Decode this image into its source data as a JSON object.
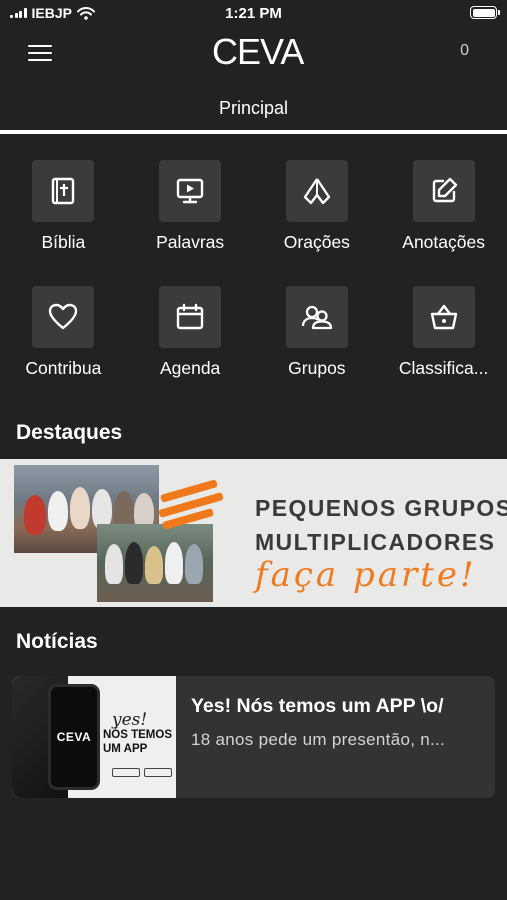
{
  "status_bar": {
    "carrier": "IEBJP",
    "time": "1:21 PM"
  },
  "header": {
    "logo_text": "CEVA",
    "counter": "0",
    "title": "Principal",
    "menu_icon": "hamburger-menu-icon"
  },
  "menu": {
    "items": [
      {
        "label": "Bíblia",
        "icon": "bible-icon"
      },
      {
        "label": "Palavras",
        "icon": "monitor-play-icon"
      },
      {
        "label": "Orações",
        "icon": "praying-hands-icon"
      },
      {
        "label": "Anotações",
        "icon": "edit-note-icon"
      },
      {
        "label": "Contribua",
        "icon": "heart-icon"
      },
      {
        "label": "Agenda",
        "icon": "calendar-icon"
      },
      {
        "label": "Grupos",
        "icon": "group-icon"
      },
      {
        "label": "Classifica...",
        "icon": "basket-icon"
      }
    ]
  },
  "highlights": {
    "title": "Destaques",
    "banner": {
      "line1": "PEQUENOS GRUPOS",
      "line2": "MULTIPLICADORES",
      "line3": "faça parte!"
    }
  },
  "news": {
    "title": "Notícias",
    "items": [
      {
        "title": "Yes! Nós temos um APP \\o/",
        "description": "18 anos pede um presentão, n...",
        "thumb_logo": "CEVA",
        "thumb_yes": "yes!",
        "thumb_line1": "NÓS TEMOS",
        "thumb_line2": "UM APP"
      }
    ]
  },
  "colors": {
    "background": "#222222",
    "tile": "#3b3b3b",
    "card": "#333333",
    "accent_orange": "#f07a1b"
  }
}
